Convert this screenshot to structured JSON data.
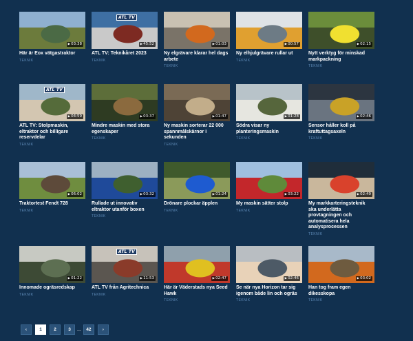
{
  "videos": [
    {
      "title": "Här är Eox vätgastraktor",
      "category": "TEKNIK",
      "duration": "03:38",
      "atl": false,
      "palette": [
        "#8fb0d0",
        "#4b6a45",
        "#6c7b3c"
      ]
    },
    {
      "title": "ATL TV: Teknikåret 2023",
      "category": "TEKNIK",
      "duration": "45:52",
      "atl": true,
      "atl_label": "ATL TV",
      "palette": [
        "#3e6fa3",
        "#7d2a22",
        "#c9c9c9"
      ]
    },
    {
      "title": "Ny elgrävare klarar hel dags arbete",
      "category": "TEKNIK",
      "duration": "01:03",
      "atl": false,
      "palette": [
        "#c9c1b2",
        "#d2691e",
        "#7a7368"
      ]
    },
    {
      "title": "Ny elhjulgrävare rullar ut",
      "category": "TEKNIK",
      "duration": "00:57",
      "atl": false,
      "palette": [
        "#dfe3e6",
        "#6d7b85",
        "#e0a030"
      ]
    },
    {
      "title": "Nytt verktyg för minskad markpackning",
      "category": "TEKNIK",
      "duration": "02:15",
      "atl": false,
      "palette": [
        "#6b8d3b",
        "#f0e030",
        "#3e4f2a"
      ]
    },
    {
      "title": "ATL TV: Stolpmaskin, eltraktor och billigare reservdelar",
      "category": "TEKNIK",
      "duration": "04:59",
      "atl": true,
      "atl_label": "ATL TV",
      "palette": [
        "#9fb7c9",
        "#556b3a",
        "#d3c6b1"
      ]
    },
    {
      "title": "Mindre maskin med stora egenskaper",
      "category": "TEKNIK",
      "duration": "03:37",
      "atl": false,
      "palette": [
        "#5d6e3a",
        "#8b6a3e",
        "#2e3b22"
      ]
    },
    {
      "title": "Ny maskin sorterar 22 000 spannmålskärnor i sekunden",
      "category": "TEKNIK",
      "duration": "01:47",
      "atl": false,
      "palette": [
        "#7a6a55",
        "#c2ad8a",
        "#4e4336"
      ]
    },
    {
      "title": "Södra visar ny planteringsmaskin",
      "category": "TEKNIK",
      "duration": "01:28",
      "atl": false,
      "palette": [
        "#b8c3c9",
        "#56663c",
        "#e6e6e0"
      ]
    },
    {
      "title": "Sensor håller koll på kraftuttagsaxeln",
      "category": "TEKNIK",
      "duration": "02:46",
      "atl": false,
      "palette": [
        "#2c3540",
        "#c9a227",
        "#6a7480"
      ]
    },
    {
      "title": "Traktortest Fendt 728",
      "category": "TEKNIK",
      "duration": "06:02",
      "atl": false,
      "palette": [
        "#a9bfd6",
        "#5d4a3a",
        "#6f8d3f"
      ]
    },
    {
      "title": "Rullade ut innovativ eltraktor utanför boxen",
      "category": "TEKNIK",
      "duration": "03:32",
      "atl": false,
      "palette": [
        "#9cb0c2",
        "#3f5f2f",
        "#1f4a9a"
      ]
    },
    {
      "title": "Drönare plockar äpplen",
      "category": "TEKNIK",
      "duration": "01:24",
      "atl": false,
      "palette": [
        "#3f5a2c",
        "#1e5bd0",
        "#8b9a5a"
      ]
    },
    {
      "title": "My maskin sätter stolp",
      "category": "TEKNIK",
      "duration": "03:22",
      "atl": false,
      "palette": [
        "#9fbfdf",
        "#5f8a3a",
        "#c3272b"
      ]
    },
    {
      "title": "My markkarteringsteknik ska underlätta provtagningen och automatisera hela analysprocessen",
      "category": "TEKNIK",
      "duration": "02:49",
      "atl": false,
      "palette": [
        "#1f2d3a",
        "#d9422c",
        "#c9b79c"
      ]
    },
    {
      "title": "Innomade ogräsredskap",
      "category": "TEKNIK",
      "duration": "01:22",
      "atl": false,
      "palette": [
        "#c7c9c2",
        "#5d6f52",
        "#3d4a35"
      ]
    },
    {
      "title": "ATL TV från Agritechnica",
      "category": "TEKNIK",
      "duration": "11:53",
      "atl": true,
      "atl_label": "ATL TV",
      "palette": [
        "#c7c2ba",
        "#8a3b2a",
        "#5b5650"
      ]
    },
    {
      "title": "Här är Väderstads nya Seed Hawk",
      "category": "TEKNIK",
      "duration": "02:47",
      "atl": false,
      "palette": [
        "#8fa0ac",
        "#e0c020",
        "#c0392b"
      ]
    },
    {
      "title": "Se när nya Horizon tar sig igenom både lin och ogräs",
      "category": "TEKNIK",
      "duration": "02:46",
      "atl": false,
      "palette": [
        "#b9bec2",
        "#4d5a66",
        "#e8d2b8"
      ]
    },
    {
      "title": "Han tog fram egen dikesskopa",
      "category": "TEKNIK",
      "duration": "03:02",
      "atl": false,
      "palette": [
        "#a8b9c9",
        "#6e5b3f",
        "#d2691e"
      ]
    }
  ],
  "pagination": {
    "prev_label": "‹",
    "pages": [
      "1",
      "2",
      "3"
    ],
    "ellipsis": "...",
    "last_page": "42",
    "next_label": "›",
    "current_page": "1"
  }
}
